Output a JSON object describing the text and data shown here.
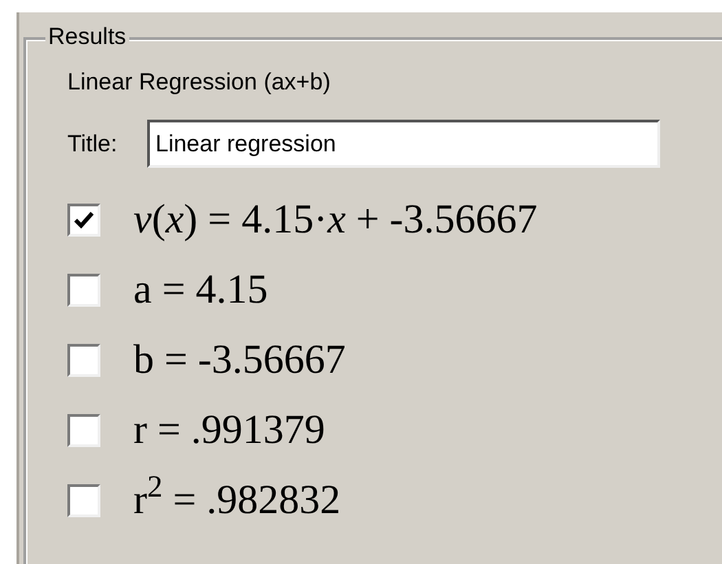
{
  "group": {
    "title": "Results"
  },
  "method": "Linear Regression (ax+b)",
  "title_field": {
    "label": "Title:",
    "value": "Linear regression"
  },
  "results": [
    {
      "text": "*v*(*x*) = 4.15·*x* + -3.56667",
      "checked": true
    },
    {
      "text": "a = 4.15",
      "checked": false
    },
    {
      "text": "b = -3.56667",
      "checked": false
    },
    {
      "text": "r = .991379",
      "checked": false
    },
    {
      "text": "r$^{2}$ = .982832",
      "checked": false
    }
  ]
}
